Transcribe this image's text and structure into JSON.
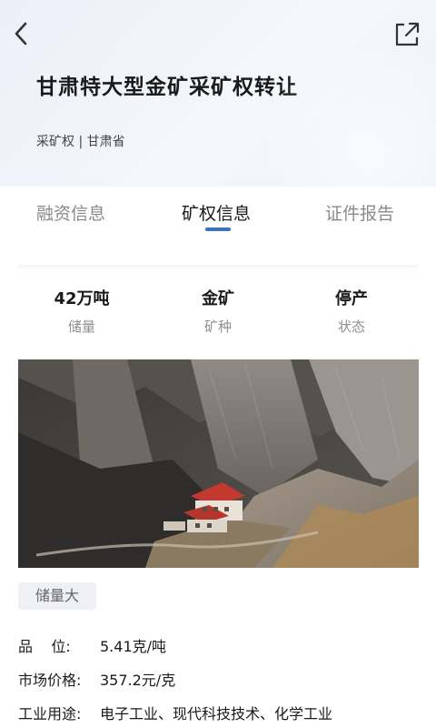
{
  "header": {
    "title": "甘肃特大型金矿采矿权转让",
    "subtitle": "采矿权 | 甘肃省",
    "back_icon": "chevron-left-icon",
    "share_icon": "share-external-icon"
  },
  "tabs": [
    {
      "label": "融资信息",
      "active": false
    },
    {
      "label": "矿权信息",
      "active": true
    },
    {
      "label": "证件报告",
      "active": false
    }
  ],
  "stats": [
    {
      "value": "42万吨",
      "label": "储量"
    },
    {
      "value": "金矿",
      "label": "矿种"
    },
    {
      "value": "停产",
      "label": "状态"
    }
  ],
  "tag": "储量大",
  "details": [
    {
      "label": "品    位:",
      "value": "5.41克/吨"
    },
    {
      "label": "市场价格:",
      "value": "357.2元/克"
    },
    {
      "label": "工业用途:",
      "value": "电子工业、现代科技技术、化学工业"
    }
  ],
  "colors": {
    "accent": "#3a74b8",
    "header_bg": "#eef3f9",
    "tag_bg": "#eef0f4"
  }
}
